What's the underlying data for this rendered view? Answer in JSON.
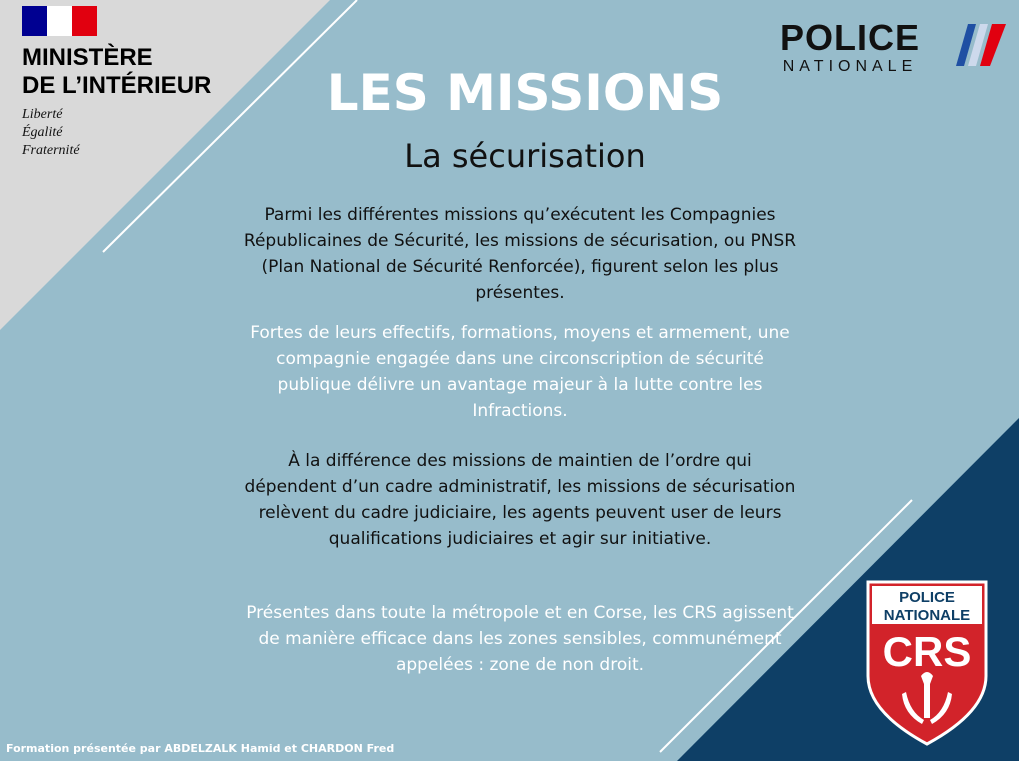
{
  "header": {
    "ministry_line1": "MINISTÈRE",
    "ministry_line2": "DE L’INTÉRIEUR",
    "motto": [
      "Liberté",
      "Égalité",
      "Fraternité"
    ],
    "police_word": "POLICE",
    "nationale_word": "NATIONALE"
  },
  "title": "LES MISSIONS",
  "subtitle": "La sécurisation",
  "paragraphs": [
    "Parmi les différentes missions qu’exécutent les Compagnies Républicaines de Sécurité, les missions de sécurisation, ou PNSR (Plan National de Sécurité Renforcée), figurent selon les plus présentes.",
    "Fortes de leurs effectifs, formations, moyens et armement, une compagnie engagée dans une circonscription de sécurité publique délivre un avantage majeur à la lutte contre les Infractions.",
    " À la différence des missions de maintien de l’ordre qui dépendent d’un cadre administratif, les missions de sécurisation relèvent du cadre judiciaire, les agents peuvent user de leurs qualifications judiciaires et agir sur initiative.",
    "Présentes dans toute la métropole et en Corse, les CRS agissent de manière efficace dans les zones sensibles, communément appelées : zone de non droit."
  ],
  "crs_badge": {
    "line1": "POLICE",
    "line2": "NATIONALE",
    "line3": "CRS"
  },
  "footer": "Formation présentée par ABDELZALK Hamid et CHARDON Fred",
  "colors": {
    "background": "#97bccb",
    "grey_corner": "#d9d9d9",
    "navy_corner": "#0e3f66",
    "badge_red": "#d2232a"
  }
}
